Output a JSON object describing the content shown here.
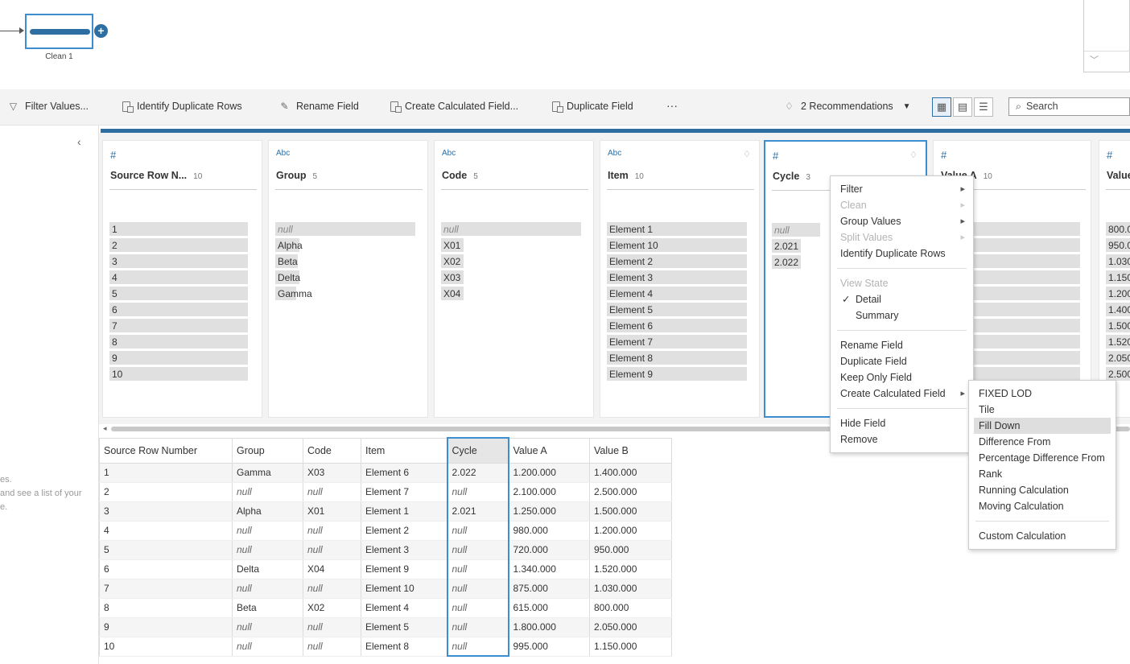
{
  "flow": {
    "node_label": "Clean 1",
    "plus": "+"
  },
  "toolbar": {
    "filter_values": "Filter Values...",
    "identify_duplicates": "Identify Duplicate Rows",
    "rename_field": "Rename Field",
    "create_calc": "Create Calculated Field...",
    "duplicate_field": "Duplicate Field",
    "more": "···",
    "recommendations": "2 Recommendations",
    "search_placeholder": "Search"
  },
  "sidebar": {
    "line1": "es.",
    "line2": "and see a list of your",
    "line3": "e."
  },
  "cards": [
    {
      "type": "#",
      "name": "Source Row N...",
      "count": "10",
      "values": [
        "1",
        "2",
        "3",
        "4",
        "5",
        "6",
        "7",
        "8",
        "9",
        "10"
      ]
    },
    {
      "type": "Abc",
      "name": "Group",
      "count": "5",
      "values": [
        "null",
        "Alpha",
        "Beta",
        "Delta",
        "Gamma"
      ]
    },
    {
      "type": "Abc",
      "name": "Code",
      "count": "5",
      "values": [
        "null",
        "X01",
        "X02",
        "X03",
        "X04"
      ]
    },
    {
      "type": "Abc",
      "name": "Item",
      "count": "10",
      "values": [
        "Element 1",
        "Element 10",
        "Element 2",
        "Element 3",
        "Element 4",
        "Element 5",
        "Element 6",
        "Element 7",
        "Element 8",
        "Element 9"
      ]
    },
    {
      "type": "#",
      "name": "Cycle",
      "count": "3",
      "values": [
        "null",
        "2.021",
        "2.022"
      ]
    },
    {
      "type": "#",
      "name": "Value A",
      "count": "10",
      "values": [
        "0",
        "0",
        "0",
        "0",
        "0",
        ".000",
        ".000",
        ".000",
        ".000",
        ".000"
      ]
    },
    {
      "type": "#",
      "name": "Value",
      "count": "",
      "values": [
        "800.0",
        "950.0",
        "1.030",
        "1.150",
        "1.200",
        "1.400",
        "1.500",
        "1.520",
        "2.050",
        "2.500"
      ]
    }
  ],
  "grid": {
    "headers": [
      "Source Row Number",
      "Group",
      "Code",
      "Item",
      "Cycle",
      "Value A",
      "Value B"
    ],
    "rows": [
      [
        "1",
        "Gamma",
        "X03",
        "Element 6",
        "2.022",
        "1.200.000",
        "1.400.000"
      ],
      [
        "2",
        "null",
        "null",
        "Element 7",
        "null",
        "2.100.000",
        "2.500.000"
      ],
      [
        "3",
        "Alpha",
        "X01",
        "Element 1",
        "2.021",
        "1.250.000",
        "1.500.000"
      ],
      [
        "4",
        "null",
        "null",
        "Element 2",
        "null",
        "980.000",
        "1.200.000"
      ],
      [
        "5",
        "null",
        "null",
        "Element 3",
        "null",
        "720.000",
        "950.000"
      ],
      [
        "6",
        "Delta",
        "X04",
        "Element 9",
        "null",
        "1.340.000",
        "1.520.000"
      ],
      [
        "7",
        "null",
        "null",
        "Element 10",
        "null",
        "875.000",
        "1.030.000"
      ],
      [
        "8",
        "Beta",
        "X02",
        "Element 4",
        "null",
        "615.000",
        "800.000"
      ],
      [
        "9",
        "null",
        "null",
        "Element 5",
        "null",
        "1.800.000",
        "2.050.000"
      ],
      [
        "10",
        "null",
        "null",
        "Element 8",
        "null",
        "995.000",
        "1.150.000"
      ]
    ]
  },
  "context_menu": {
    "filter": "Filter",
    "clean": "Clean",
    "group_values": "Group Values",
    "split_values": "Split Values",
    "identify_duplicates": "Identify Duplicate Rows",
    "view_state": "View State",
    "detail": "Detail",
    "summary": "Summary",
    "check": "✓",
    "rename": "Rename Field",
    "duplicate": "Duplicate Field",
    "keep_only": "Keep Only Field",
    "create_calc": "Create Calculated Field",
    "hide": "Hide Field",
    "remove": "Remove"
  },
  "submenu": {
    "fixed_lod": "FIXED LOD",
    "tile": "Tile",
    "fill_down": "Fill Down",
    "difference_from": "Difference From",
    "pct_difference_from": "Percentage Difference From",
    "rank": "Rank",
    "running_calc": "Running Calculation",
    "moving_calc": "Moving Calculation",
    "custom_calc": "Custom Calculation"
  },
  "colors": {
    "accent": "#2d6fa3",
    "selection": "#3d8ed0"
  }
}
